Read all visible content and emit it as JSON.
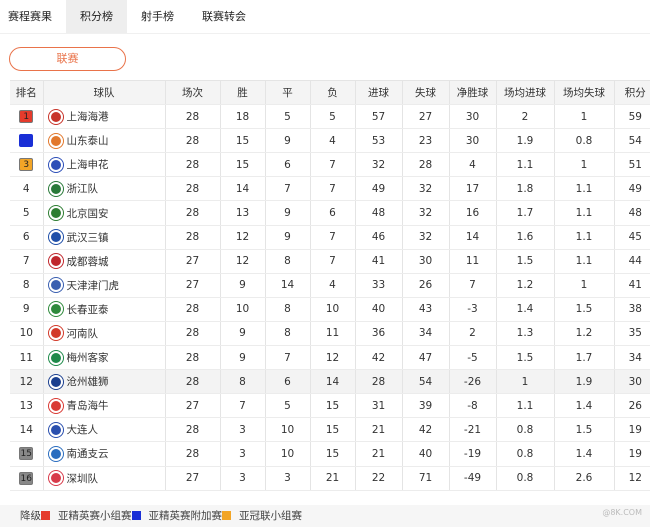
{
  "tabs": [
    {
      "label": "赛程赛果",
      "active": false
    },
    {
      "label": "积分榜",
      "active": true
    },
    {
      "label": "射手榜",
      "active": false
    },
    {
      "label": "联赛转会",
      "active": false
    }
  ],
  "filter_button": "联赛",
  "table": {
    "headers": [
      "排名",
      "球队",
      "场次",
      "胜",
      "平",
      "负",
      "进球",
      "失球",
      "净胜球",
      "场均进球",
      "场均失球",
      "积分"
    ],
    "rows": [
      {
        "rank": "1",
        "team": "上海海港",
        "played": "28",
        "w": "18",
        "d": "5",
        "l": "5",
        "gf": "57",
        "ga": "27",
        "gd": "30",
        "avg_gf": "2",
        "avg_ga": "1",
        "pts": "59",
        "badge_color": "#e53b2c",
        "logo_color": "#c8342a"
      },
      {
        "rank": "2",
        "team": "山东泰山",
        "played": "28",
        "w": "15",
        "d": "9",
        "l": "4",
        "gf": "53",
        "ga": "23",
        "gd": "30",
        "avg_gf": "1.9",
        "avg_ga": "0.8",
        "pts": "54",
        "badge_color": "#1a2fd6",
        "logo_color": "#e2782d"
      },
      {
        "rank": "3",
        "team": "上海申花",
        "played": "28",
        "w": "15",
        "d": "6",
        "l": "7",
        "gf": "32",
        "ga": "28",
        "gd": "4",
        "avg_gf": "1.1",
        "avg_ga": "1",
        "pts": "51",
        "badge_color": "#f2a527",
        "logo_color": "#2d4fb8"
      },
      {
        "rank": "4",
        "team": "浙江队",
        "played": "28",
        "w": "14",
        "d": "7",
        "l": "7",
        "gf": "49",
        "ga": "32",
        "gd": "17",
        "avg_gf": "1.8",
        "avg_ga": "1.1",
        "pts": "49",
        "badge_color": "",
        "logo_color": "#2a7a3a"
      },
      {
        "rank": "5",
        "team": "北京国安",
        "played": "28",
        "w": "13",
        "d": "9",
        "l": "6",
        "gf": "48",
        "ga": "32",
        "gd": "16",
        "avg_gf": "1.7",
        "avg_ga": "1.1",
        "pts": "48",
        "badge_color": "",
        "logo_color": "#2e7d32"
      },
      {
        "rank": "6",
        "team": "武汉三镇",
        "played": "28",
        "w": "12",
        "d": "9",
        "l": "7",
        "gf": "46",
        "ga": "32",
        "gd": "14",
        "avg_gf": "1.6",
        "avg_ga": "1.1",
        "pts": "45",
        "badge_color": "",
        "logo_color": "#1f4fa8"
      },
      {
        "rank": "7",
        "team": "成都蓉城",
        "played": "27",
        "w": "12",
        "d": "8",
        "l": "7",
        "gf": "41",
        "ga": "30",
        "gd": "11",
        "avg_gf": "1.5",
        "avg_ga": "1.1",
        "pts": "44",
        "badge_color": "",
        "logo_color": "#c0272d"
      },
      {
        "rank": "8",
        "team": "天津津门虎",
        "played": "27",
        "w": "9",
        "d": "14",
        "l": "4",
        "gf": "33",
        "ga": "26",
        "gd": "7",
        "avg_gf": "1.2",
        "avg_ga": "1",
        "pts": "41",
        "badge_color": "",
        "logo_color": "#3a5fb0"
      },
      {
        "rank": "9",
        "team": "长春亚泰",
        "played": "28",
        "w": "10",
        "d": "8",
        "l": "10",
        "gf": "40",
        "ga": "43",
        "gd": "-3",
        "avg_gf": "1.4",
        "avg_ga": "1.5",
        "pts": "38",
        "badge_color": "",
        "logo_color": "#2f8a3c"
      },
      {
        "rank": "10",
        "team": "河南队",
        "played": "28",
        "w": "9",
        "d": "8",
        "l": "11",
        "gf": "36",
        "ga": "34",
        "gd": "2",
        "avg_gf": "1.3",
        "avg_ga": "1.2",
        "pts": "35",
        "badge_color": "",
        "logo_color": "#d23a2a"
      },
      {
        "rank": "11",
        "team": "梅州客家",
        "played": "28",
        "w": "9",
        "d": "7",
        "l": "12",
        "gf": "42",
        "ga": "47",
        "gd": "-5",
        "avg_gf": "1.5",
        "avg_ga": "1.7",
        "pts": "34",
        "badge_color": "",
        "logo_color": "#1e8a4a"
      },
      {
        "rank": "12",
        "team": "沧州雄狮",
        "played": "28",
        "w": "8",
        "d": "6",
        "l": "14",
        "gf": "28",
        "ga": "54",
        "gd": "-26",
        "avg_gf": "1",
        "avg_ga": "1.9",
        "pts": "30",
        "badge_color": "",
        "logo_color": "#1b3f8f"
      },
      {
        "rank": "13",
        "team": "青岛海牛",
        "played": "27",
        "w": "7",
        "d": "5",
        "l": "15",
        "gf": "31",
        "ga": "39",
        "gd": "-8",
        "avg_gf": "1.1",
        "avg_ga": "1.4",
        "pts": "26",
        "badge_color": "",
        "logo_color": "#d93a34"
      },
      {
        "rank": "14",
        "team": "大连人",
        "played": "28",
        "w": "3",
        "d": "10",
        "l": "15",
        "gf": "21",
        "ga": "42",
        "gd": "-21",
        "avg_gf": "0.8",
        "avg_ga": "1.5",
        "pts": "19",
        "badge_color": "",
        "logo_color": "#2a4fae"
      },
      {
        "rank": "15",
        "team": "南通支云",
        "played": "28",
        "w": "3",
        "d": "10",
        "l": "15",
        "gf": "21",
        "ga": "40",
        "gd": "-19",
        "avg_gf": "0.8",
        "avg_ga": "1.4",
        "pts": "19",
        "badge_color": "#888888",
        "logo_color": "#2a6dbf"
      },
      {
        "rank": "16",
        "team": "深圳队",
        "played": "27",
        "w": "3",
        "d": "3",
        "l": "21",
        "gf": "22",
        "ga": "71",
        "gd": "-49",
        "avg_gf": "0.8",
        "avg_ga": "2.6",
        "pts": "12",
        "badge_color": "#888888",
        "logo_color": "#d83a4a"
      }
    ]
  },
  "legend": [
    {
      "label": "降级",
      "color": "#e53b2c"
    },
    {
      "label": "亚精英赛小组赛",
      "color": "#1a2fd6"
    },
    {
      "label": "亚精英赛附加赛",
      "color": "#f2a527"
    },
    {
      "label": "亚冠联小组赛",
      "color": ""
    }
  ],
  "watermark": "@8K.COM"
}
